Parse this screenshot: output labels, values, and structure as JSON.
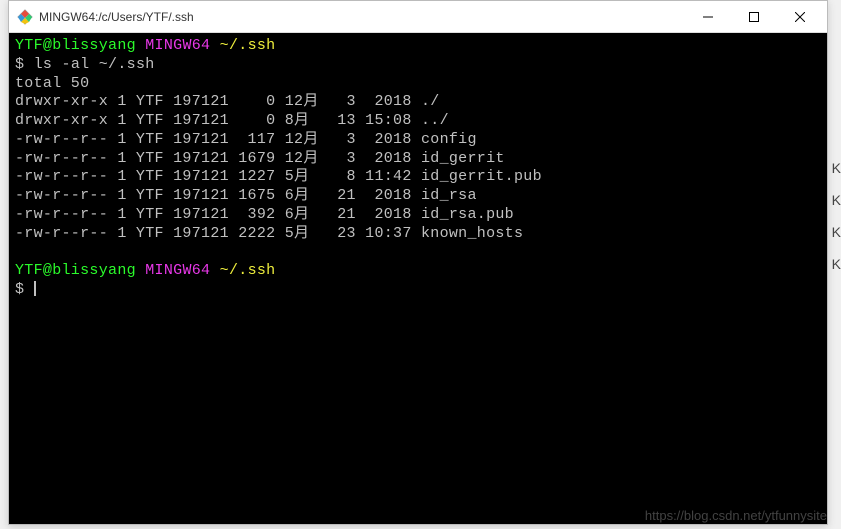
{
  "window": {
    "title": "MINGW64:/c/Users/YTF/.ssh"
  },
  "prompt": {
    "user": "YTF@blissyang",
    "host": "MINGW64",
    "path": "~/.ssh",
    "symbol": "$"
  },
  "command": "ls -al ~/.ssh",
  "output": {
    "total": "total 50",
    "entries": [
      {
        "perm": "drwxr-xr-x",
        "links": "1",
        "owner": "YTF",
        "group": "197121",
        "size": "   0",
        "month": "12月",
        "day": "  3",
        "time": " 2018",
        "name": "./"
      },
      {
        "perm": "drwxr-xr-x",
        "links": "1",
        "owner": "YTF",
        "group": "197121",
        "size": "   0",
        "month": "8月 ",
        "day": " 13",
        "time": "15:08",
        "name": "../"
      },
      {
        "perm": "-rw-r--r--",
        "links": "1",
        "owner": "YTF",
        "group": "197121",
        "size": " 117",
        "month": "12月",
        "day": "  3",
        "time": " 2018",
        "name": "config"
      },
      {
        "perm": "-rw-r--r--",
        "links": "1",
        "owner": "YTF",
        "group": "197121",
        "size": "1679",
        "month": "12月",
        "day": "  3",
        "time": " 2018",
        "name": "id_gerrit"
      },
      {
        "perm": "-rw-r--r--",
        "links": "1",
        "owner": "YTF",
        "group": "197121",
        "size": "1227",
        "month": "5月 ",
        "day": "  8",
        "time": "11:42",
        "name": "id_gerrit.pub"
      },
      {
        "perm": "-rw-r--r--",
        "links": "1",
        "owner": "YTF",
        "group": "197121",
        "size": "1675",
        "month": "6月 ",
        "day": " 21",
        "time": " 2018",
        "name": "id_rsa"
      },
      {
        "perm": "-rw-r--r--",
        "links": "1",
        "owner": "YTF",
        "group": "197121",
        "size": " 392",
        "month": "6月 ",
        "day": " 21",
        "time": " 2018",
        "name": "id_rsa.pub"
      },
      {
        "perm": "-rw-r--r--",
        "links": "1",
        "owner": "YTF",
        "group": "197121",
        "size": "2222",
        "month": "5月 ",
        "day": " 23",
        "time": "10:37",
        "name": "known_hosts"
      }
    ]
  },
  "watermark": "https://blog.csdn.net/ytfunnysite",
  "side": [
    "K",
    "K",
    "K",
    "K"
  ]
}
